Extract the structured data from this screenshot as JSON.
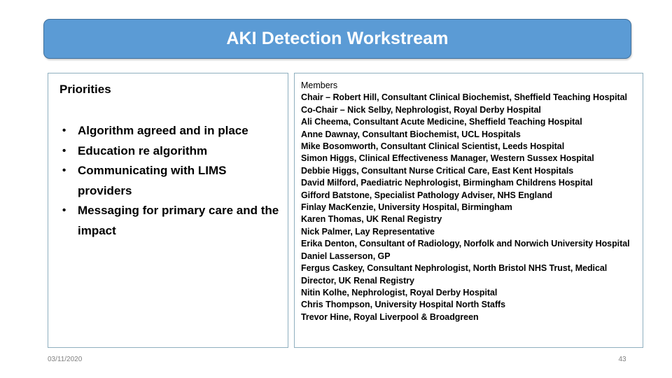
{
  "slide": {
    "title": "AKI Detection Workstream",
    "accent_color": "#5B9BD5",
    "panel_border_color": "#8FAFBF",
    "title_text_color": "#FFFFFF"
  },
  "priorities": {
    "heading": "Priorities",
    "items": [
      "Algorithm agreed and in place",
      "Education re algorithm",
      "Communicating with LIMS providers",
      "Messaging for primary care and the impact"
    ]
  },
  "members": {
    "heading": "Members",
    "items": [
      "Chair – Robert Hill, Consultant Clinical Biochemist, Sheffield Teaching Hospital",
      "Co-Chair – Nick Selby, Nephrologist, Royal Derby Hospital",
      "Ali Cheema, Consultant Acute Medicine, Sheffield Teaching Hospital",
      "Anne Dawnay, Consultant Biochemist, UCL Hospitals",
      "Mike Bosomworth, Consultant Clinical Scientist, Leeds Hospital",
      "Simon Higgs, Clinical Effectiveness Manager, Western Sussex Hospital",
      "Debbie Higgs, Consultant Nurse Critical Care, East Kent Hospitals",
      "David Milford, Paediatric Nephrologist, Birmingham Childrens Hospital",
      "Gifford Batstone, Specialist Pathology Adviser, NHS England",
      "Finlay MacKenzie, University Hospital, Birmingham",
      "Karen Thomas, UK Renal Registry",
      "Nick Palmer, Lay Representative",
      "Erika Denton, Consultant of Radiology, Norfolk and Norwich University Hospital",
      "Daniel Lasserson, GP",
      "Fergus Caskey, Consultant Nephrologist, North Bristol NHS Trust, Medical Director, UK Renal Registry",
      "Nitin Kolhe, Nephrologist, Royal Derby Hospital",
      "Chris Thompson, University Hospital North Staffs",
      "Trevor Hine, Royal Liverpool & Broadgreen"
    ]
  },
  "footer": {
    "date": "03/11/2020",
    "page_number": "43"
  }
}
